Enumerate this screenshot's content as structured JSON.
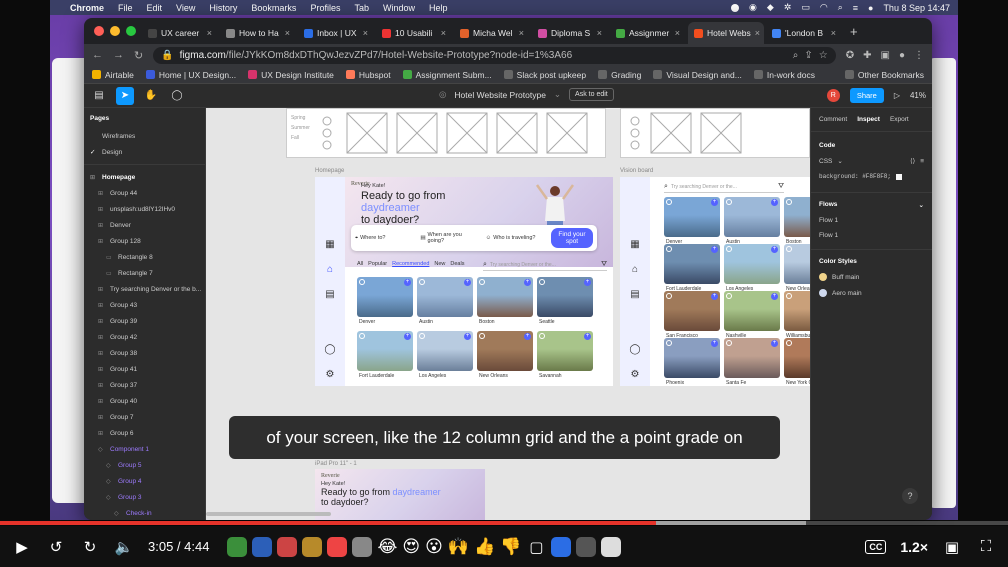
{
  "menubar": {
    "app": "Chrome",
    "items": [
      "File",
      "Edit",
      "View",
      "History",
      "Bookmarks",
      "Profiles",
      "Tab",
      "Window",
      "Help"
    ],
    "datetime": "Thu 8 Sep  14:47"
  },
  "tabs": [
    {
      "label": "UX career",
      "color": "#444"
    },
    {
      "label": "How to Ha",
      "color": "#888"
    },
    {
      "label": "Inbox | UX",
      "color": "#2b6de5"
    },
    {
      "label": "10 Usabili",
      "color": "#e33"
    },
    {
      "label": "Micha Wel",
      "color": "#e3622b"
    },
    {
      "label": "Diploma S",
      "color": "#d14ea3"
    },
    {
      "label": "Assignmer",
      "color": "#4a4"
    },
    {
      "label": "Hotel Webs",
      "color": "#f24e1e",
      "active": true
    },
    {
      "label": "'London B",
      "color": "#4285f4"
    }
  ],
  "url": {
    "domain": "figma.com",
    "path": "/file/JYkKOm8dxDThQwJezvZPd7/Hotel-Website-Prototype?node-id=1%3A66"
  },
  "bookmarks": [
    {
      "label": "Airtable",
      "color": "#f4b400"
    },
    {
      "label": "Home | UX Design...",
      "color": "#3b5bdb"
    },
    {
      "label": "UX Design Institute",
      "color": "#d6336c"
    },
    {
      "label": "Hubspot",
      "color": "#ff7a59"
    },
    {
      "label": "Assignment Subm...",
      "color": "#4a4"
    },
    {
      "label": "Slack post upkeep",
      "color": "#666"
    },
    {
      "label": "Grading",
      "color": "#666"
    },
    {
      "label": "Visual Design and...",
      "color": "#666"
    },
    {
      "label": "In-work docs",
      "color": "#666"
    },
    {
      "label": "Other Bookmarks",
      "color": "#666"
    }
  ],
  "figma": {
    "file_title": "Hotel Website Prototype",
    "ask_to_edit": "Ask to edit",
    "share": "Share",
    "zoom": "41%",
    "avatar": "R",
    "pages_title": "Pages",
    "pages": [
      "Wireframes",
      "Design"
    ],
    "layers": [
      {
        "label": "Homepage",
        "indent": 0,
        "bold": true
      },
      {
        "label": "Group 44",
        "indent": 1
      },
      {
        "label": "unsplash:ud8lY12IHv0",
        "indent": 1
      },
      {
        "label": "Denver",
        "indent": 1
      },
      {
        "label": "Group 128",
        "indent": 1
      },
      {
        "label": "Rectangle 8",
        "indent": 2
      },
      {
        "label": "Rectangle 7",
        "indent": 2
      },
      {
        "label": "Try searching Denver or the b...",
        "indent": 1
      },
      {
        "label": "Group 43",
        "indent": 1
      },
      {
        "label": "Group 39",
        "indent": 1
      },
      {
        "label": "Group 42",
        "indent": 1
      },
      {
        "label": "Group 38",
        "indent": 1
      },
      {
        "label": "Group 41",
        "indent": 1
      },
      {
        "label": "Group 37",
        "indent": 1
      },
      {
        "label": "Group 40",
        "indent": 1
      },
      {
        "label": "Group 7",
        "indent": 1
      },
      {
        "label": "Group 6",
        "indent": 1
      },
      {
        "label": "Component 1",
        "indent": 1,
        "purple": true
      },
      {
        "label": "Group 5",
        "indent": 2,
        "purple": true
      },
      {
        "label": "Group 4",
        "indent": 2,
        "purple": true
      },
      {
        "label": "Group 3",
        "indent": 2,
        "purple": true
      },
      {
        "label": "Check-in",
        "indent": 3,
        "purple": true
      }
    ],
    "right_tabs": [
      "Comment",
      "Inspect",
      "Export"
    ],
    "code_title": "Code",
    "css_label": "CSS",
    "background_line": "background: #F8F8F8;",
    "flows_title": "Flows",
    "flows": [
      "Flow 1",
      "Flow 1"
    ],
    "color_styles_title": "Color Styles",
    "color_styles": [
      {
        "name": "Buff main",
        "color": "#f0d38a"
      },
      {
        "name": "Aero main",
        "color": "#cfd9ee"
      }
    ]
  },
  "canvas": {
    "homepage_label": "Homepage",
    "vision_label": "Vision board",
    "ipad_label": "iPad Pro 11\" - 1",
    "brand": "Reverie",
    "hey": "Hey Kate!",
    "headline_1": "Ready to go from ",
    "headline_em": "daydreamer",
    "headline_2": "to daydoer?",
    "fields": [
      "Where to?",
      "When are you going?",
      "Who is traveling?"
    ],
    "find_btn": "Find your spot",
    "filters": [
      "All",
      "Popular",
      "Recommended",
      "New",
      "Deals"
    ],
    "search_placeholder": "Try searching Denver or the...",
    "home_cards": [
      "Denver",
      "Austin",
      "Boston",
      "Seattle",
      "Fort Lauderdale",
      "Los Angeles",
      "New Orleans",
      "Savannah"
    ],
    "vision_cards": [
      "Denver",
      "Austin",
      "Boston",
      "Fort Lauderdale",
      "Los Angeles",
      "New Orleans",
      "San Francisco",
      "Nashville",
      "Williamsburg",
      "Phoenix",
      "Santa Fe",
      "New York C"
    ],
    "wire_labels": [
      "Spring",
      "Summer",
      "Fall"
    ]
  },
  "caption": "of your screen, like the 12 column grid and the a point grade on",
  "video": {
    "current": "3:05",
    "total": "4:44",
    "played_fraction": 0.651,
    "buffered_fraction": 0.8,
    "speed": "1.2×",
    "cc": "CC"
  }
}
